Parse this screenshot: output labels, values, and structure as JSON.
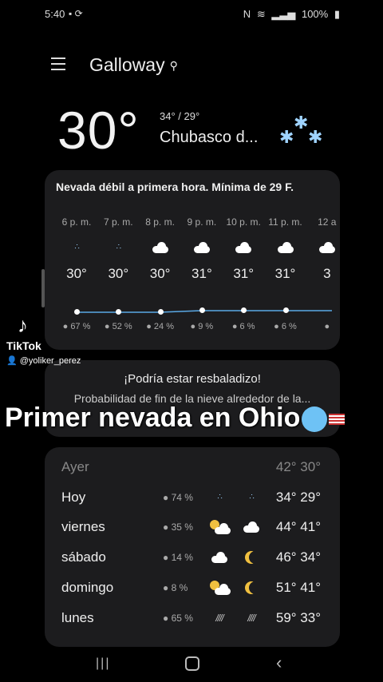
{
  "status_bar": {
    "time": "5:40",
    "battery": "100%"
  },
  "header": {
    "location": "Galloway"
  },
  "current": {
    "temp": "30°",
    "hilo": "34° / 29°",
    "condition": "Chubasco d..."
  },
  "hourly": {
    "summary": "Nevada débil a primera hora. Mínima de 29 F.",
    "hours": [
      {
        "time": "6 p. m.",
        "icon": "snow-icon",
        "temp": "30°",
        "precip": "67 %"
      },
      {
        "time": "7 p. m.",
        "icon": "snow-icon",
        "temp": "30°",
        "precip": "52 %"
      },
      {
        "time": "8 p. m.",
        "icon": "cloud-icon",
        "temp": "30°",
        "precip": "24 %"
      },
      {
        "time": "9 p. m.",
        "icon": "cloud-icon",
        "temp": "31°",
        "precip": "9 %"
      },
      {
        "time": "10 p. m.",
        "icon": "cloud-icon",
        "temp": "31°",
        "precip": "6 %"
      },
      {
        "time": "11 p. m.",
        "icon": "cloud-icon",
        "temp": "31°",
        "precip": "6 %"
      },
      {
        "time": "12 a",
        "icon": "cloud-icon",
        "temp": "3",
        "precip": ""
      }
    ]
  },
  "alert": {
    "title": "¡Podría estar resbaladizo!",
    "description": "Probabilidad de fin de la nieve alrededor de la..."
  },
  "overlay": {
    "caption": "Primer nevada en Ohio",
    "tiktok_name": "TikTok",
    "tiktok_user": "@yoliker_perez"
  },
  "daily": [
    {
      "day": "Ayer",
      "precip": "",
      "icon_day": "",
      "icon_night": "",
      "temps": "42° 30°",
      "yesterday": true
    },
    {
      "day": "Hoy",
      "precip": "74 %",
      "icon_day": "snow-icon",
      "icon_night": "snow-icon",
      "temps": "34° 29°"
    },
    {
      "day": "viernes",
      "precip": "35 %",
      "icon_day": "sun-cloud-rain-icon",
      "icon_night": "cloud-icon",
      "temps": "44° 41°"
    },
    {
      "day": "sábado",
      "precip": "14 %",
      "icon_day": "cloud-icon",
      "icon_night": "moon-icon",
      "temps": "46° 34°"
    },
    {
      "day": "domingo",
      "precip": "8 %",
      "icon_day": "sun-cloud-icon",
      "icon_night": "moon-icon",
      "temps": "51° 41°"
    },
    {
      "day": "lunes",
      "precip": "65 %",
      "icon_day": "rain-icon",
      "icon_night": "rain-icon",
      "temps": "59° 33°"
    }
  ]
}
